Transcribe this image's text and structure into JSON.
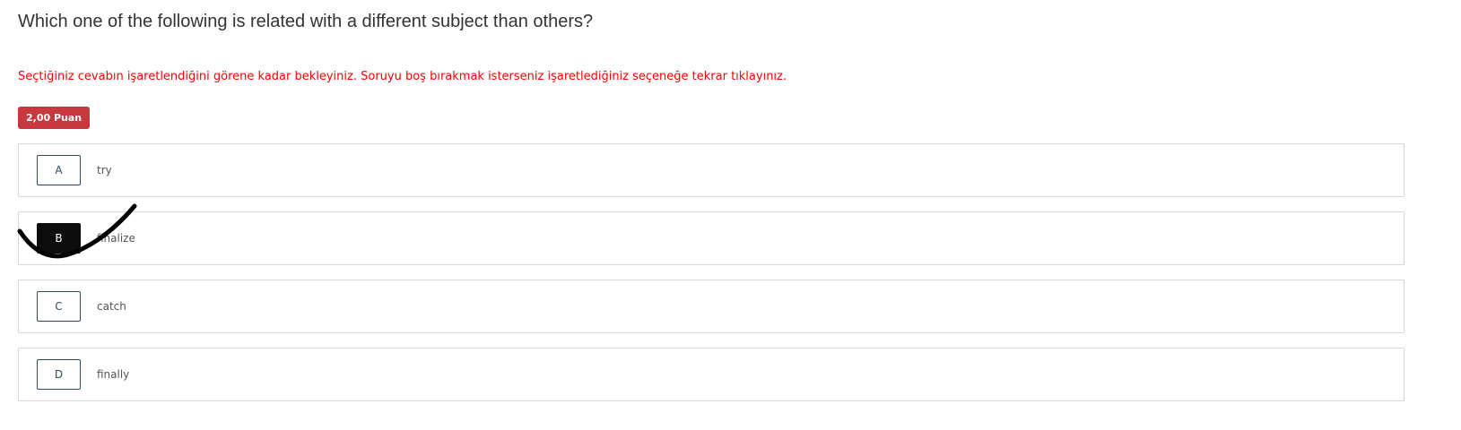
{
  "question": {
    "text": "Which one of the following is related with a different subject than others?",
    "instruction": "Seçtiğiniz cevabın işaretlendiğini görene kadar bekleyiniz. Soruyu boş bırakmak isterseniz işaretlediğiniz seçeneğe tekrar tıklayınız.",
    "points_label": "2,00 Puan"
  },
  "options": [
    {
      "letter": "A",
      "text": "try",
      "selected": false
    },
    {
      "letter": "B",
      "text": "finalize",
      "selected": true
    },
    {
      "letter": "C",
      "text": "catch",
      "selected": false
    },
    {
      "letter": "D",
      "text": "finally",
      "selected": false
    }
  ],
  "colors": {
    "instruction": "#ff0000",
    "badge": "#c9373f",
    "selected_letter_bg": "#0d0d0d",
    "letter_border": "#2c4a6b"
  }
}
